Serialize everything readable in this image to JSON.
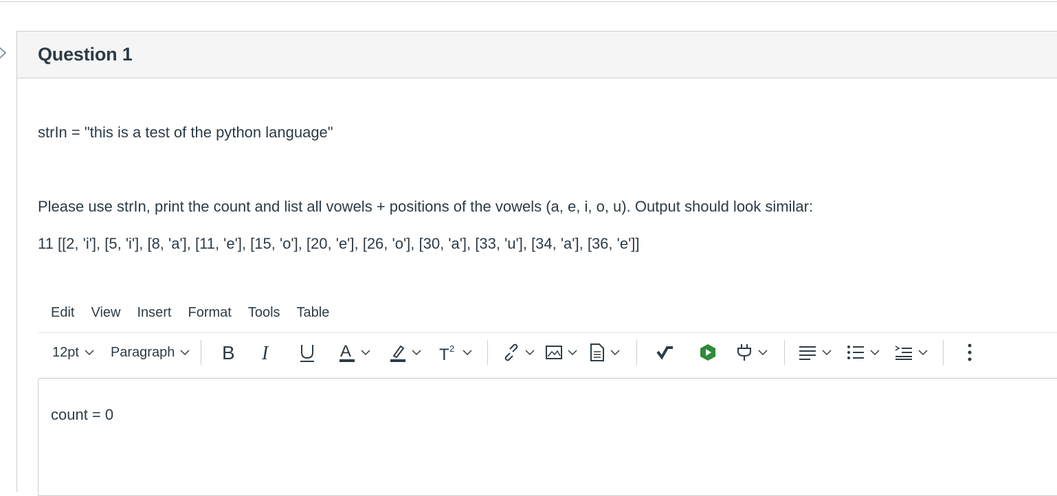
{
  "question": {
    "title": "Question 1",
    "line1": "strIn = \"this is a test of the python language\"",
    "line2": "Please use strIn, print the count and list all vowels + positions of the vowels (a, e, i, o, u). Output should look similar:",
    "line3": "11 [[2, 'i'], [5, 'i'], [8, 'a'], [11, 'e'], [15, 'o'], [20, 'e'], [26, 'o'], [30, 'a'], [33, 'u'], [34, 'a'], [36, 'e']]"
  },
  "menubar": {
    "items": [
      "Edit",
      "View",
      "Insert",
      "Format",
      "Tools",
      "Table"
    ]
  },
  "toolbar": {
    "font_size": "12pt",
    "block_format": "Paragraph",
    "bold_icon": "bold-icon",
    "italic_icon": "italic-icon",
    "underline_icon": "underline-icon",
    "text_color_icon": "text-color-icon",
    "highlight_icon": "highlight-icon",
    "superscript_icon": "superscript-icon",
    "link_icon": "link-icon",
    "image_icon": "image-icon",
    "document_icon": "document-icon",
    "equation_icon": "equation-icon",
    "app_icon": "app-icon",
    "plugin_icon": "plugin-icon",
    "align_icon": "align-icon",
    "list_icon": "bullet-list-icon",
    "indent_icon": "indent-icon",
    "more_icon": "more-icon",
    "accent_underline_color": "#2d3b45",
    "app_icon_color": "#2e8b3a"
  },
  "editor": {
    "content": "count = 0"
  }
}
